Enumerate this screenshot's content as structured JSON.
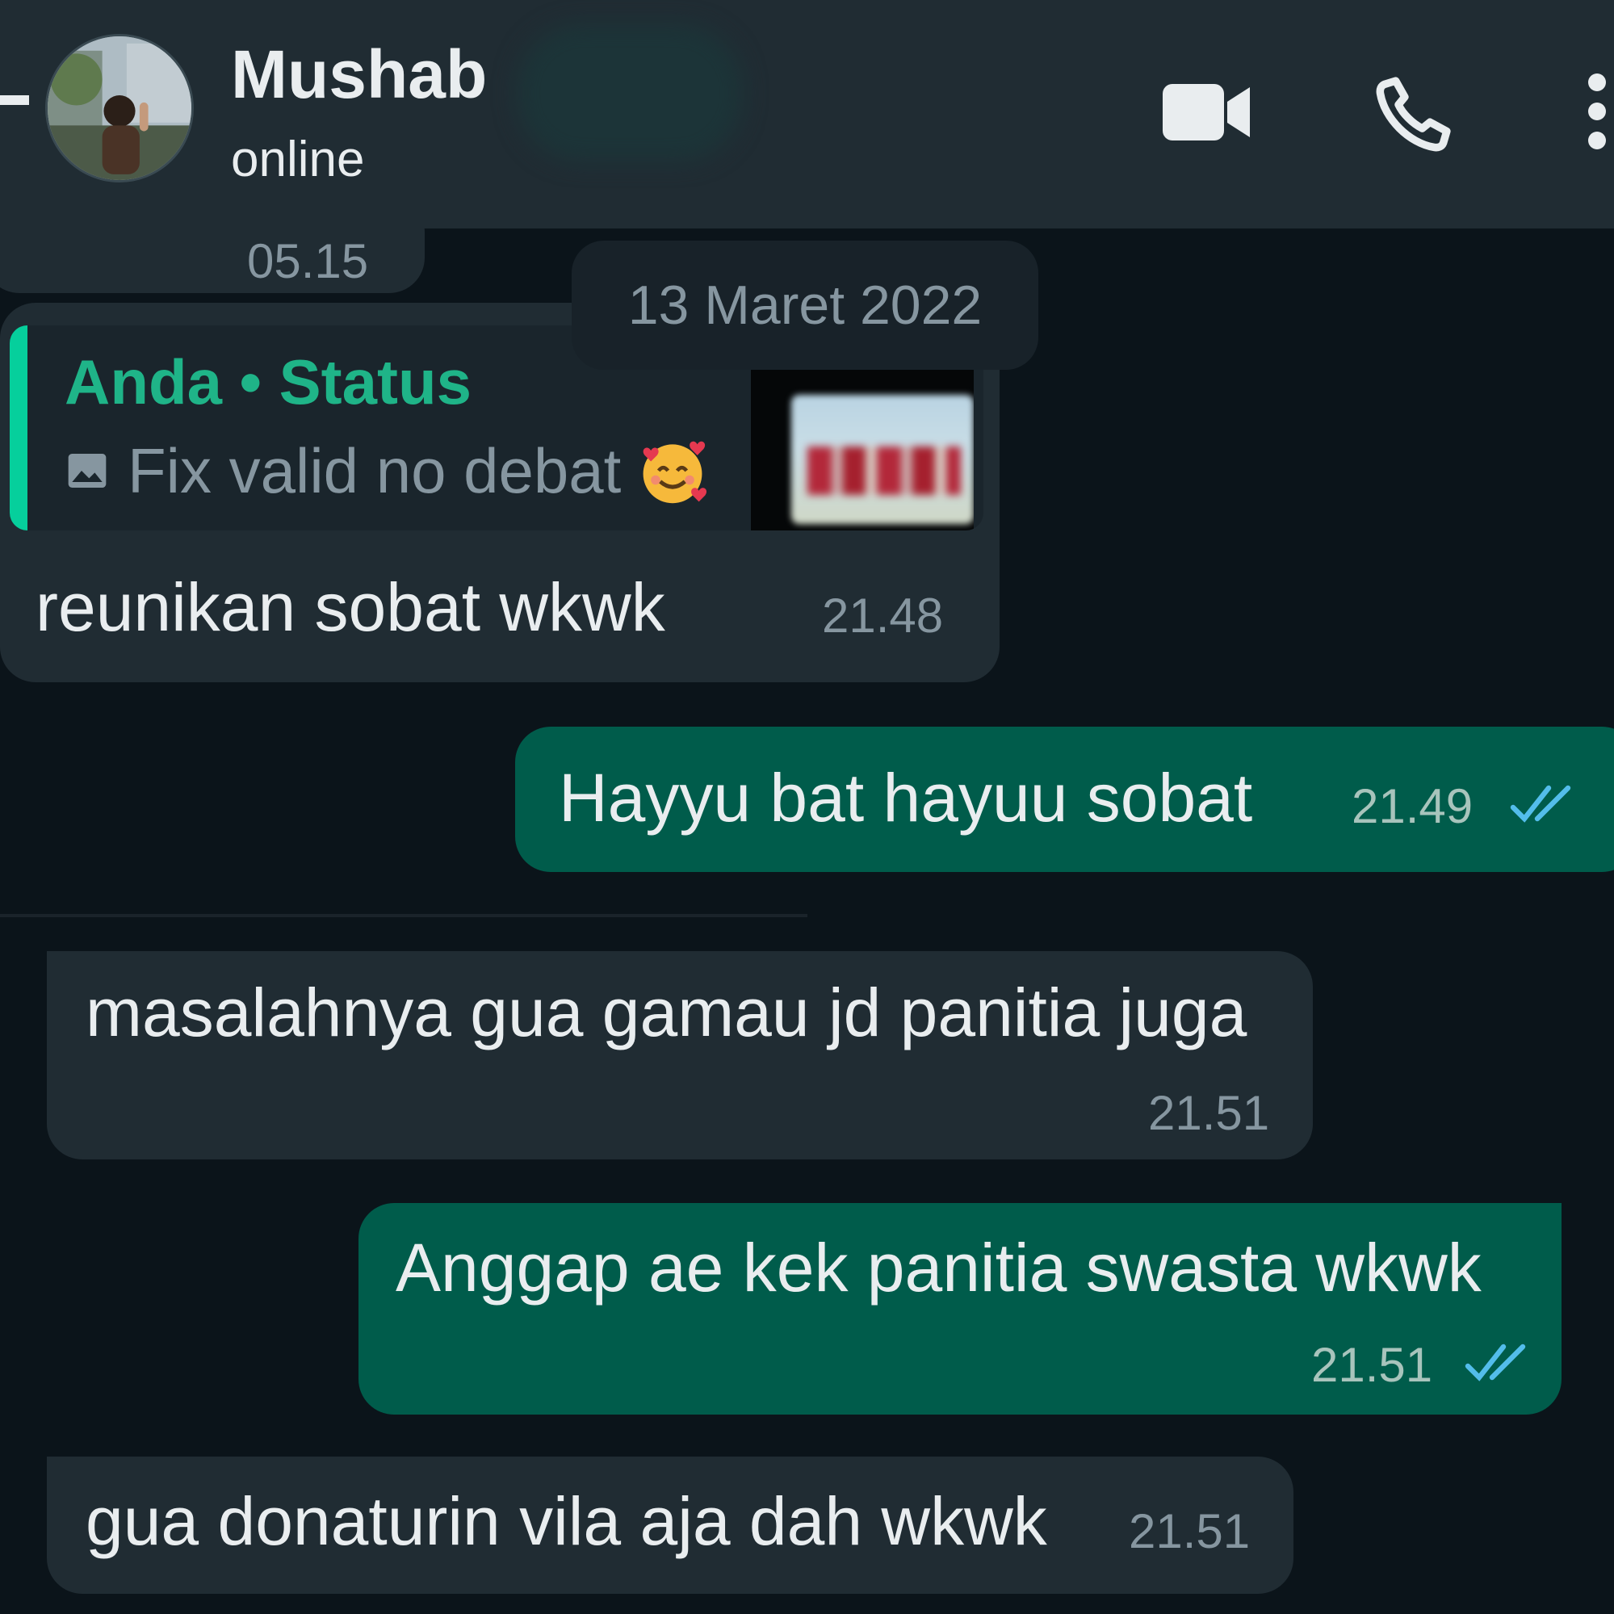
{
  "header": {
    "contact_name": "Mushab",
    "contact_status": "online",
    "icons": [
      "back-arrow-icon",
      "avatar",
      "video-call-icon",
      "voice-call-icon",
      "more-options-icon"
    ]
  },
  "chat": {
    "cut_message_time": "05.15",
    "date_label": "13 Maret 2022",
    "messages": [
      {
        "direction": "incoming",
        "reply_to": {
          "author": "Anda • Status",
          "text": "Fix valid no debat",
          "icon": "photo-icon",
          "emoji": "smiling-face-with-hearts"
        },
        "text": "reunikan sobat wkwk",
        "time": "21.48"
      },
      {
        "direction": "outgoing",
        "text": "Hayyu bat hayuu sobat",
        "time": "21.49",
        "status": "read"
      },
      {
        "direction": "incoming",
        "text": "masalahnya gua gamau jd panitia juga",
        "time": "21.51"
      },
      {
        "direction": "outgoing",
        "text": "Anggap ae kek panitia swasta wkwk",
        "time": "21.51",
        "status": "read"
      },
      {
        "direction": "incoming",
        "text": "gua donaturin vila aja dah wkwk",
        "time": "21.51"
      }
    ]
  },
  "colors": {
    "header_bg": "#202c33",
    "chat_bg": "#0b141a",
    "incoming_bubble": "#202c33",
    "outgoing_bubble": "#005c4b",
    "quote_accent": "#06cf9c",
    "read_ticks": "#53bdeb"
  }
}
